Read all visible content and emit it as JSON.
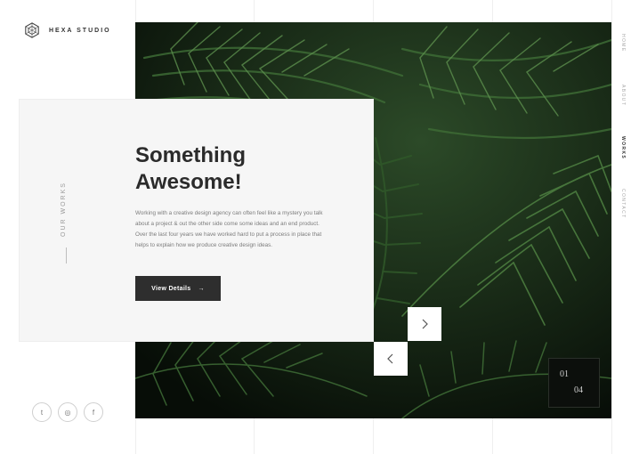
{
  "brand": {
    "name": "HEXA STUDIO"
  },
  "section": {
    "label": "OUR WORKS"
  },
  "hero": {
    "title_line1": "Something",
    "title_line2": "Awesome!",
    "body": "Working with a creative design agency can often feel like a mystery you talk about a project & out the other side come some ideas and an end product. Over the last four years we have worked hard to put a process in place that helps to explain how we produce creative design ideas.",
    "cta_label": "View Details",
    "cta_arrow": "→"
  },
  "slider": {
    "current": "01",
    "total": "04",
    "next_icon": "chevron-right-icon",
    "prev_icon": "chevron-left-icon"
  },
  "nav": {
    "items": [
      {
        "label": "HOME",
        "active": false
      },
      {
        "label": "ABOUT",
        "active": false
      },
      {
        "label": "WORKS",
        "active": true
      },
      {
        "label": "CONTACT",
        "active": false
      }
    ]
  },
  "social": [
    {
      "icon": "twitter-icon",
      "glyph": "t"
    },
    {
      "icon": "instagram-icon",
      "glyph": "◎"
    },
    {
      "icon": "facebook-icon",
      "glyph": "f"
    }
  ],
  "colors": {
    "accent": "#2e2e2e",
    "panel": "#f6f6f6",
    "foliage": "#1f3a1f"
  }
}
